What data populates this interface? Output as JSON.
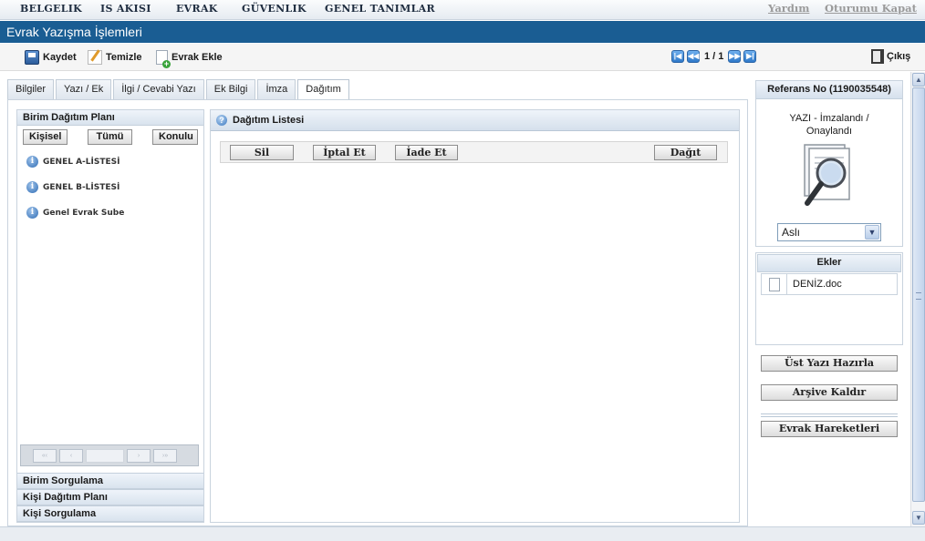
{
  "topmenu": {
    "items": [
      "BELGELIK",
      "IS AKISI",
      "EVRAK",
      "GÜVENLIK",
      "GENEL TANIMLAR"
    ],
    "help": "Yardım",
    "logout": "Oturumu Kapat"
  },
  "title": "Evrak Yazışma İşlemleri",
  "toolbar": {
    "save": "Kaydet",
    "clear": "Temizle",
    "add_doc": "Evrak Ekle",
    "pager_text": "1 / 1",
    "exit": "Çıkış"
  },
  "tabs": [
    {
      "label": "Bilgiler"
    },
    {
      "label": "Yazı / Ek"
    },
    {
      "label": "İlgi / Cevabi Yazı"
    },
    {
      "label": "Ek Bilgi"
    },
    {
      "label": "İmza"
    },
    {
      "label": "Dağıtım",
      "active": true
    }
  ],
  "left": {
    "header": "Birim Dağıtım Planı",
    "subtabs": [
      "Kişisel",
      "Tümü",
      "Konulu"
    ],
    "items": [
      "GENEL A-LİSTESİ",
      "GENEL B-LİSTESİ",
      "Genel Evrak Sube"
    ],
    "bottom_sections": [
      "Birim Sorgulama",
      "Kişi Dağıtım Planı",
      "Kişi Sorgulama"
    ]
  },
  "center": {
    "header": "Dağıtım Listesi",
    "actions": {
      "delete": "Sil",
      "cancel": "İptal Et",
      "return": "İade Et",
      "distribute": "Dağıt"
    }
  },
  "right": {
    "reference": "Referans No (1190035548)",
    "status_line1": "YAZI - İmzalandı /",
    "status_line2": "Onaylandı",
    "select_value": "Aslı",
    "attachments_header": "Ekler",
    "attachments": [
      "DENİZ.doc"
    ],
    "buttons": {
      "prepare": "Üst Yazı Hazırla",
      "unarchive": "Arşive Kaldır",
      "history": "Evrak Hareketleri"
    }
  },
  "icons": {
    "info": "info-icon",
    "help": "help-icon",
    "save": "floppy-disk-icon",
    "clear": "pencil-icon",
    "add": "add-document-icon",
    "exit": "door-exit-icon"
  },
  "colors": {
    "titlebar": "#1a5d93",
    "panel_header": "#d9e3ee",
    "pager_button": "#2f79c9"
  }
}
